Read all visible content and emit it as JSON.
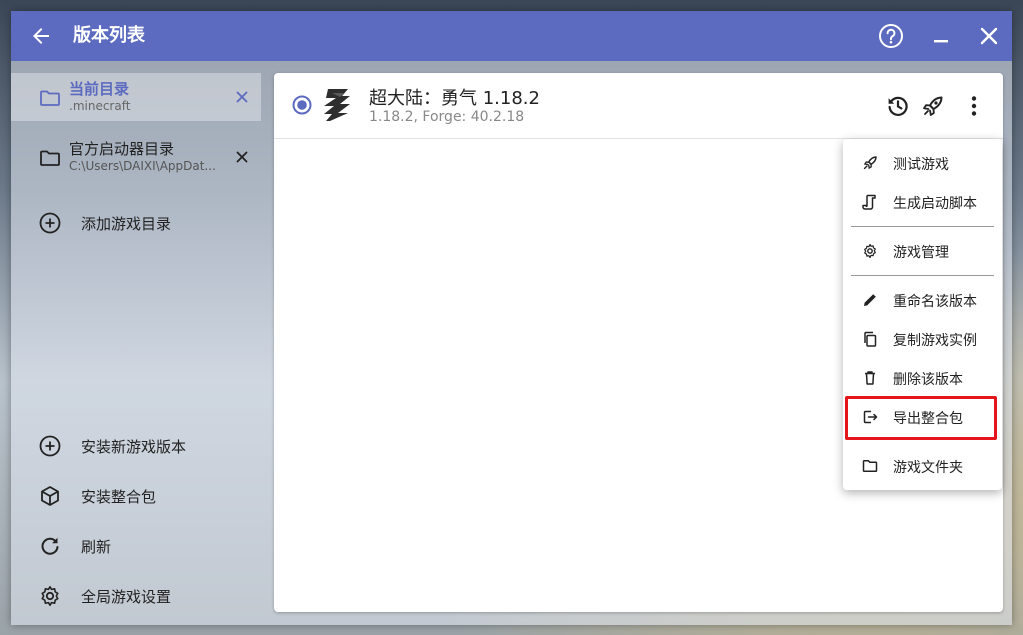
{
  "window": {
    "title": "版本列表"
  },
  "sidebar": {
    "directories": [
      {
        "name": "当前目录",
        "path": ".minecraft",
        "active": true
      },
      {
        "name": "官方启动器目录",
        "path": "C:\\Users\\DAIXI\\AppDat...",
        "active": false
      }
    ],
    "add_directory_label": "添加游戏目录",
    "actions": [
      {
        "label": "安装新游戏版本",
        "icon": "plus-circle-icon"
      },
      {
        "label": "安装整合包",
        "icon": "package-icon"
      },
      {
        "label": "刷新",
        "icon": "refresh-icon"
      },
      {
        "label": "全局游戏设置",
        "icon": "gear-icon"
      }
    ]
  },
  "version": {
    "name": "超大陆：勇气 1.18.2",
    "details": "1.18.2, Forge: 40.2.18"
  },
  "context_menu": {
    "items": [
      {
        "label": "测试游戏",
        "icon": "rocket-icon"
      },
      {
        "label": "生成启动脚本",
        "icon": "script-icon"
      },
      {
        "label": "游戏管理",
        "icon": "gear-icon"
      },
      {
        "label": "重命名该版本",
        "icon": "pencil-icon"
      },
      {
        "label": "复制游戏实例",
        "icon": "copy-icon"
      },
      {
        "label": "删除该版本",
        "icon": "trash-icon"
      },
      {
        "label": "导出整合包",
        "icon": "export-icon",
        "highlighted": true
      },
      {
        "label": "游戏文件夹",
        "icon": "folder-icon"
      }
    ]
  },
  "colors": {
    "accent": "#5c6bc0",
    "highlight": "#e5161b"
  }
}
